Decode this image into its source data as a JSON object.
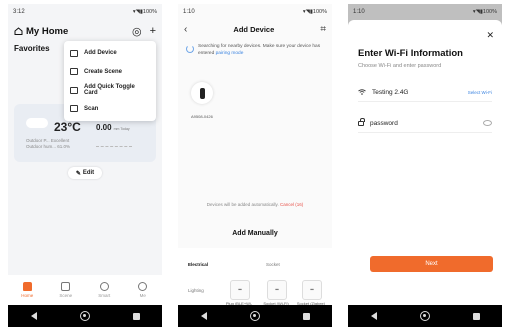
{
  "phone1": {
    "status": {
      "time": "3:12",
      "right": "▾◥▮100%"
    },
    "title": "My Home",
    "favorites": "Favorites",
    "menu": [
      {
        "icon": "add-device-icon",
        "label": "Add Device"
      },
      {
        "icon": "create-scene-icon",
        "label": "Create Scene"
      },
      {
        "icon": "quick-toggle-icon",
        "label": "Add Quick Toggle Card"
      },
      {
        "icon": "scan-icon",
        "label": "Scan"
      }
    ],
    "weather": {
      "temp": "23°C",
      "line1": "Outdoor P... Excellent",
      "line2": "Outdoor hum... 61.0%",
      "rain": "0.00",
      "rain_unit": "mm Today"
    },
    "edit": "Edit",
    "tabs": [
      {
        "icon": "home-icon",
        "label": "Home"
      },
      {
        "icon": "scene-icon",
        "label": "Scene"
      },
      {
        "icon": "smart-icon",
        "label": "Smart"
      },
      {
        "icon": "me-icon",
        "label": "Me"
      }
    ]
  },
  "phone2": {
    "status": {
      "time": "1:10",
      "right": "▾◥▮100%"
    },
    "title": "Add Device",
    "search_text": "Searching for nearby devices. Make sure your device has entered",
    "search_link": "pairing mode",
    "device_name": "A9508-0426",
    "auto_text": "Devices will be added automatically.",
    "cancel": "Cancel (16)",
    "add_manually": "Add Manually",
    "cat_electrical": "Electrical",
    "cat_lighting": "Lighting",
    "socket_header": "Socket",
    "plugs": [
      {
        "label": "Plug (BLE+Wi-Fi)"
      },
      {
        "label": "Socket (Wi-Fi)"
      },
      {
        "label": "Socket (Zigbee)"
      }
    ]
  },
  "phone3": {
    "status": {
      "time": "1:10",
      "right": "▾◥▮100%"
    },
    "title": "Enter Wi-Fi Information",
    "subtitle": "Choose Wi-Fi and enter password",
    "ssid": "Testing 2.4G",
    "select_wifi": "Select Wi-Fi",
    "password": "password",
    "next": "Next"
  },
  "colors": {
    "accent": "#f06b2c",
    "link": "#3a83e0"
  }
}
